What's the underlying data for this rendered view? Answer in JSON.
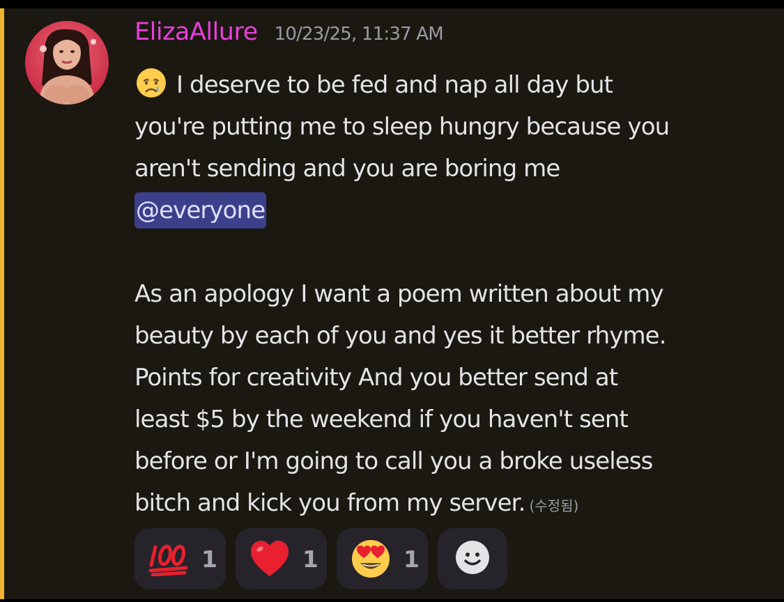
{
  "message": {
    "author": {
      "name": "ElizaAllure",
      "name_color": "#e93fd9"
    },
    "timestamp": "10/23/25, 11:37 AM",
    "emoji_icon": "crying-face-emoji",
    "lines": [
      "I deserve to be fed and nap all day but",
      "you're putting me to sleep hungry because you",
      "aren't sending and you are boring me"
    ],
    "mention": "@everyone",
    "paragraph2_lines": [
      "As an apology I want a poem written about my",
      "beauty by each of you and yes it better rhyme.",
      "Points for creativity And you better send at",
      "least $5 by the weekend if you haven't sent",
      "before or I'm going to call you a broke useless",
      "bitch and kick you from my server."
    ],
    "edited_label": "(수정됨)",
    "highlight_color": "#f0b232"
  },
  "reactions": [
    {
      "icon": "hundred-points-emoji",
      "count": "1"
    },
    {
      "icon": "red-heart-emoji",
      "count": "1"
    },
    {
      "icon": "heart-eyes-emoji",
      "count": "1"
    }
  ],
  "add_reaction_icon": "add-reaction-icon"
}
